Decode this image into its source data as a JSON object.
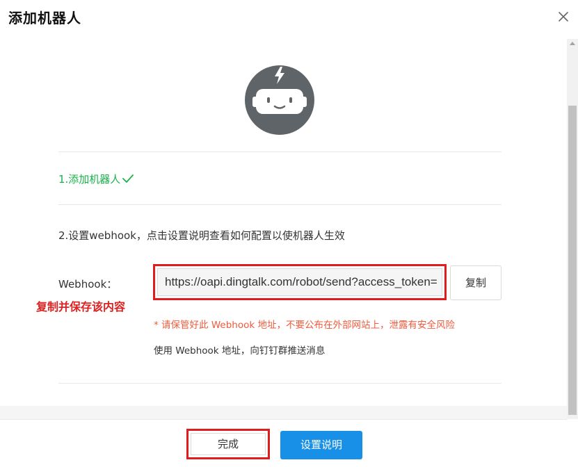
{
  "dialog": {
    "title": "添加机器人"
  },
  "steps": {
    "step1": "1.添加机器人",
    "step2": "2.设置webhook，点击设置说明查看如何配置以使机器人生效"
  },
  "webhook": {
    "label": "Webhook：",
    "url": "https://oapi.dingtalk.com/robot/send?access_token=",
    "copy_button": "复制",
    "annotation": "复制并保存该内容",
    "warning": "* 请保管好此 Webhook 地址，不要公布在外部网站上，泄露有安全风险",
    "info": "使用 Webhook 地址，向钉钉群推送消息"
  },
  "footer": {
    "done_button": "完成",
    "setup_button": "设置说明"
  },
  "colors": {
    "success": "#19b34a",
    "primary": "#1890e8",
    "warning": "#f05a3c",
    "highlight": "#e21c1c",
    "avatar": "#5f6468"
  },
  "icons": {
    "close": "close-icon",
    "check": "check-icon",
    "robot": "robot-icon"
  }
}
